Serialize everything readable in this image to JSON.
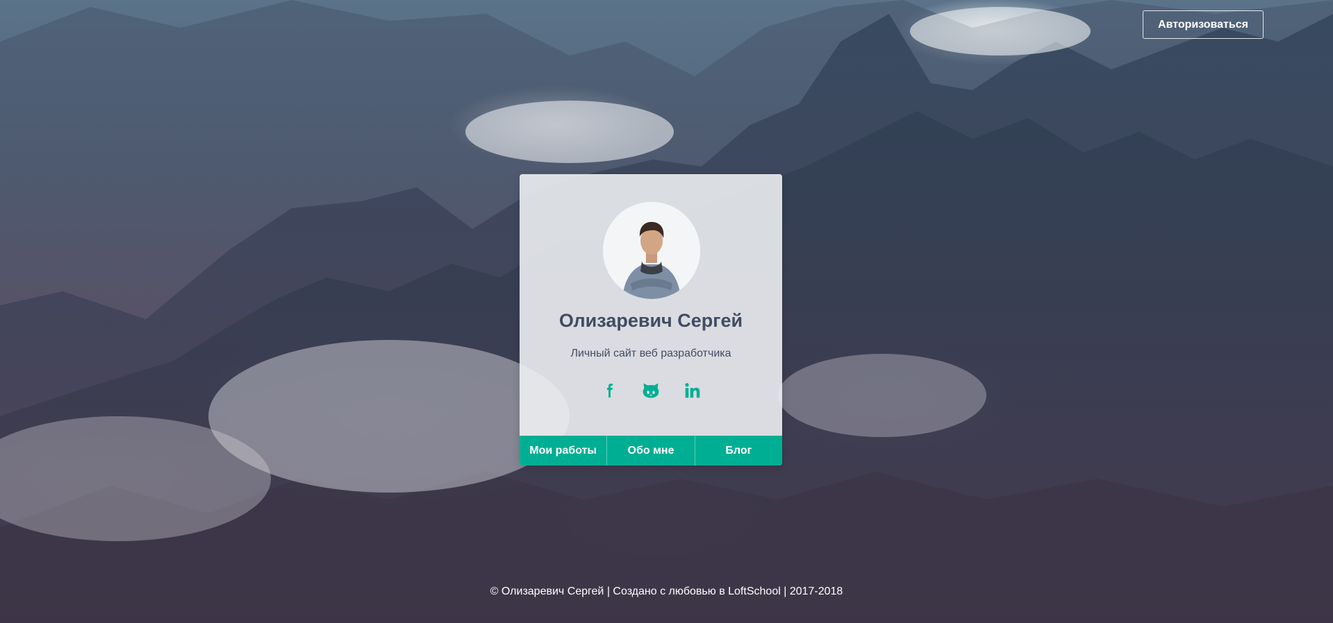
{
  "header": {
    "auth_label": "Авторизоваться"
  },
  "card": {
    "name": "Олизаревич Сергей",
    "subtitle": "Личный сайт веб разработчика",
    "socials": [
      {
        "icon": "facebook-icon"
      },
      {
        "icon": "github-icon"
      },
      {
        "icon": "linkedin-icon"
      }
    ],
    "nav": [
      {
        "label": "Мои работы"
      },
      {
        "label": "Обо мне"
      },
      {
        "label": "Блог"
      }
    ]
  },
  "footer": {
    "text": "© Олизаревич Сергей | Создано с любовью в LoftSchool | 2017-2018"
  },
  "colors": {
    "accent": "#00af93",
    "text_dark": "#414c63"
  }
}
